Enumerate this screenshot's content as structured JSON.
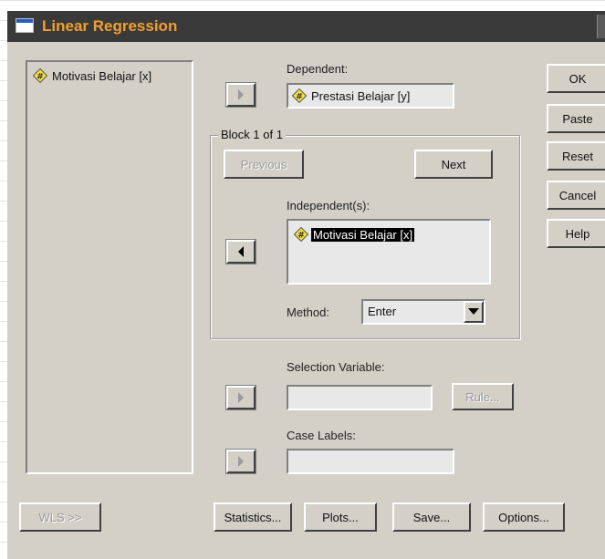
{
  "window": {
    "title": "Linear Regression"
  },
  "source_variables": [
    {
      "label": "Motivasi Belajar [x]",
      "icon": "scale-variable-icon"
    }
  ],
  "dependent": {
    "label": "Dependent:",
    "value": "Prestasi Belajar [y]"
  },
  "block": {
    "label": "Block 1 of 1",
    "previous_label": "Previous",
    "next_label": "Next"
  },
  "independents": {
    "label": "Independent(s):",
    "items": [
      {
        "label": "Motivasi Belajar [x]",
        "icon": "scale-variable-icon",
        "selected": true
      }
    ]
  },
  "method": {
    "label": "Method:",
    "value": "Enter"
  },
  "selection_variable": {
    "label": "Selection Variable:",
    "rule_label": "Rule..."
  },
  "case_labels": {
    "label": "Case Labels:"
  },
  "side_buttons": [
    "OK",
    "Paste",
    "Reset",
    "Cancel",
    "Help"
  ],
  "bottom_buttons": {
    "wls": "WLS >>",
    "statistics": "Statistics...",
    "plots": "Plots...",
    "save": "Save...",
    "options": "Options..."
  },
  "colors": {
    "title_bar_bg": "#3a3a3a",
    "title_text": "#f0a030",
    "dialog_face": "#d4d0c8",
    "selection_bg": "#000000"
  }
}
